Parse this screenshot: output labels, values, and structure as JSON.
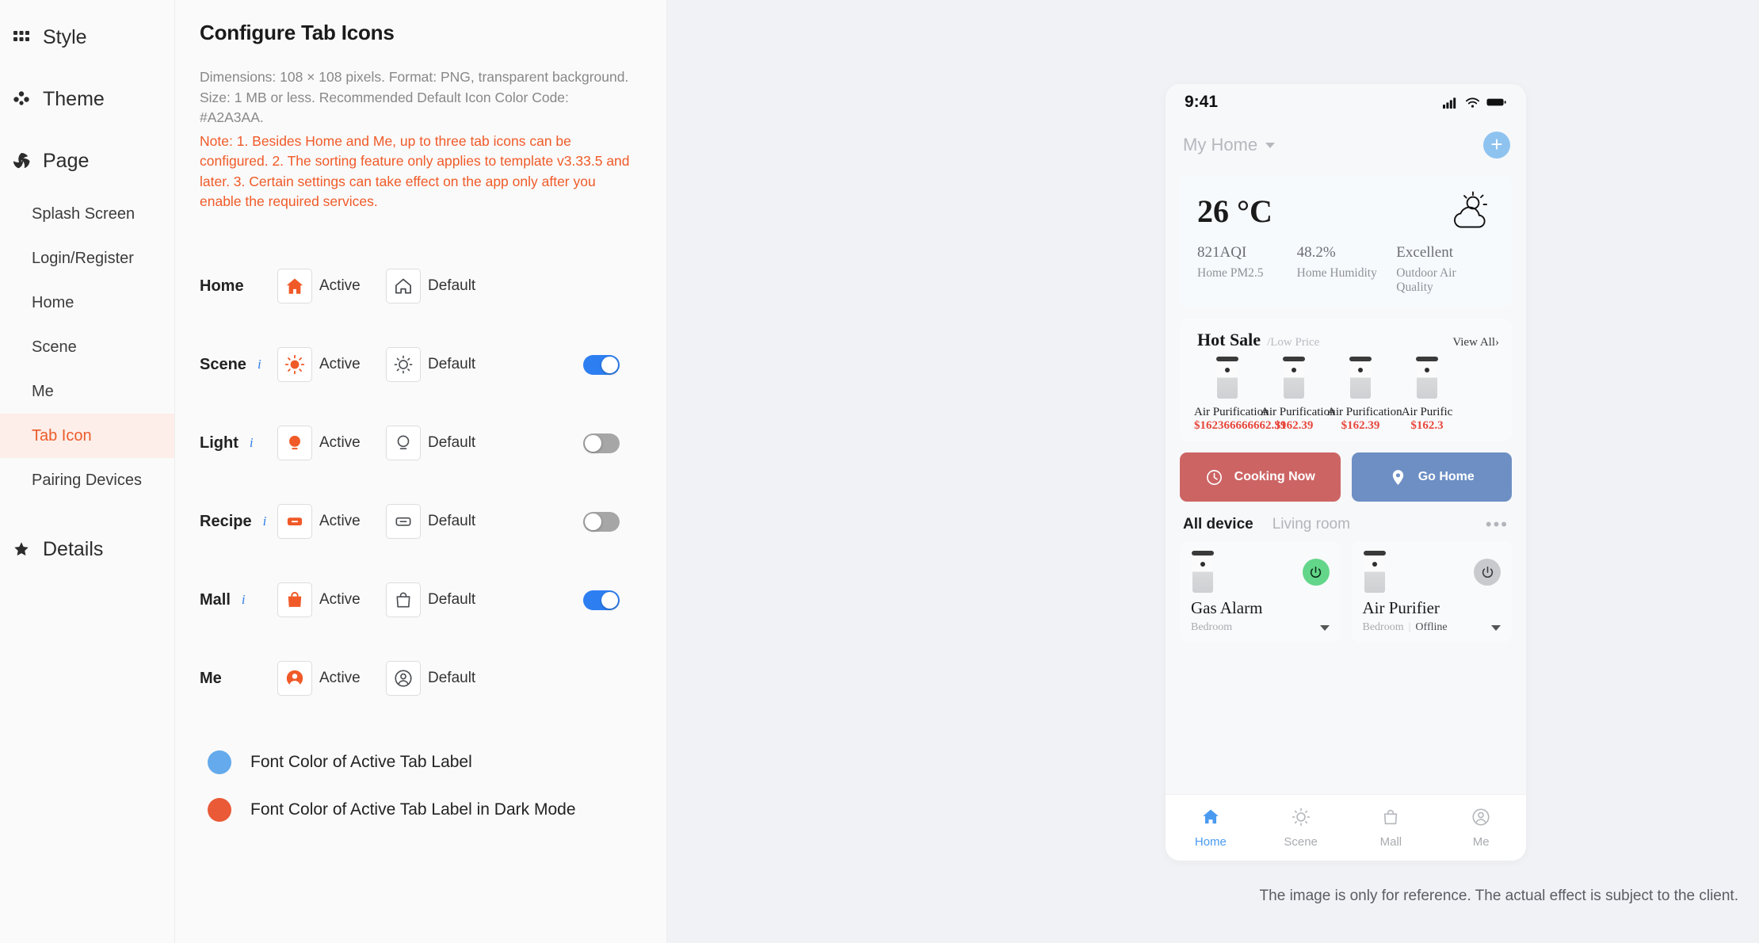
{
  "sidebar": {
    "groups": [
      {
        "label": "Style",
        "icon": "grid-icon"
      },
      {
        "label": "Theme",
        "icon": "palette-icon"
      },
      {
        "label": "Page",
        "icon": "aperture-icon"
      }
    ],
    "page_items": [
      {
        "label": "Splash Screen",
        "active": false
      },
      {
        "label": "Login/Register",
        "active": false
      },
      {
        "label": "Home",
        "active": false
      },
      {
        "label": "Scene",
        "active": false
      },
      {
        "label": "Me",
        "active": false
      },
      {
        "label": "Tab Icon",
        "active": true
      },
      {
        "label": "Pairing Devices",
        "active": false
      }
    ],
    "details": {
      "label": "Details",
      "icon": "star-icon"
    },
    "active_color": "#ec5b2a",
    "active_bg": "#fdeee9"
  },
  "panel": {
    "title": "Configure Tab Icons",
    "description": "Dimensions: 108 × 108 pixels. Format: PNG, transparent background. Size: 1 MB or less. Recommended Default Icon Color Code: #A2A3AA.",
    "note": "Note: 1. Besides Home and Me, up to three tab icons can be configured. 2. The sorting feature only applies to template v3.33.5 and later. 3. Certain settings can take effect on the app only after you enable the required services.",
    "note_color": "#f05a28",
    "active_caption": "Active",
    "default_caption": "Default",
    "info_marker": "i",
    "rows": [
      {
        "label": "Home",
        "icon": "home-icon",
        "has_info": false,
        "toggle": null
      },
      {
        "label": "Scene",
        "icon": "sun-icon",
        "has_info": true,
        "toggle": "on"
      },
      {
        "label": "Light",
        "icon": "bulb-icon",
        "has_info": true,
        "toggle": "off"
      },
      {
        "label": "Recipe",
        "icon": "recipe-icon",
        "has_info": true,
        "toggle": "off"
      },
      {
        "label": "Mall",
        "icon": "bag-icon",
        "has_info": true,
        "toggle": "on"
      },
      {
        "label": "Me",
        "icon": "person-icon",
        "has_info": false,
        "toggle": null
      }
    ],
    "colors": [
      {
        "label": "Font Color of Active Tab Label",
        "value": "#64aaec"
      },
      {
        "label": "Font Color of Active Tab Label in Dark Mode",
        "value": "#ea5a37"
      }
    ]
  },
  "preview": {
    "disclaimer": "The image is only for reference. The actual effect is subject to the client.",
    "status": {
      "time": "9:41",
      "signal": "cellular-icon",
      "wifi": "wifi-icon",
      "battery": "battery-icon"
    },
    "header": {
      "home_name": "My Home",
      "add_label": "+"
    },
    "weather": {
      "temperature": "26 °C",
      "icon": "sun-cloud-icon",
      "stats": [
        {
          "value": "821AQI",
          "label": "Home PM2.5"
        },
        {
          "value": "48.2%",
          "label": "Home Humidity"
        },
        {
          "value": "Excellent",
          "label": "Outdoor Air Quality"
        }
      ]
    },
    "hot_sale": {
      "title": "Hot Sale",
      "subtitle": "/Low Price",
      "view_all": "View All›",
      "products": [
        {
          "name": "Air Purification",
          "price": "$162366666662.39"
        },
        {
          "name": "Air Purification",
          "price": "$162.39"
        },
        {
          "name": "Air Purification",
          "price": "$162.39"
        },
        {
          "name": "Air Purific",
          "price": "$162.3"
        }
      ]
    },
    "actions": [
      {
        "label": "Cooking Now",
        "icon": "clock-icon",
        "color": "#cd6464"
      },
      {
        "label": "Go Home",
        "icon": "pin-icon",
        "color": "#6d8fc4"
      }
    ],
    "devices_header": {
      "tabs": [
        {
          "label": "All device",
          "active": true
        },
        {
          "label": "Living room",
          "active": false
        }
      ],
      "more": "more-icon"
    },
    "devices": [
      {
        "name": "Gas Alarm",
        "room": "Bedroom",
        "status": "",
        "power": "on"
      },
      {
        "name": "Air Purifier",
        "room": "Bedroom",
        "status": "Offline",
        "power": "off"
      }
    ],
    "tabbar": [
      {
        "label": "Home",
        "icon": "home-icon",
        "active": true
      },
      {
        "label": "Scene",
        "icon": "sun-icon",
        "active": false
      },
      {
        "label": "Mall",
        "icon": "bag-icon",
        "active": false
      },
      {
        "label": "Me",
        "icon": "person-icon",
        "active": false
      }
    ]
  }
}
